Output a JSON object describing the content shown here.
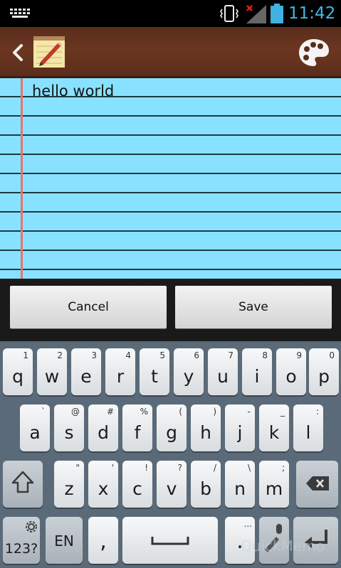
{
  "status": {
    "time": "11:42"
  },
  "header": {
    "app_icon": "notepad-pencil-icon",
    "back_icon": "back-arrow-icon",
    "palette_icon": "palette-icon"
  },
  "note": {
    "text": "hello world"
  },
  "actions": {
    "cancel_label": "Cancel",
    "save_label": "Save"
  },
  "keyboard": {
    "row1": [
      {
        "key": "q",
        "alt": "1"
      },
      {
        "key": "w",
        "alt": "2"
      },
      {
        "key": "e",
        "alt": "3"
      },
      {
        "key": "r",
        "alt": "4"
      },
      {
        "key": "t",
        "alt": "5"
      },
      {
        "key": "y",
        "alt": "6"
      },
      {
        "key": "u",
        "alt": "7"
      },
      {
        "key": "i",
        "alt": "8"
      },
      {
        "key": "o",
        "alt": "9"
      },
      {
        "key": "p",
        "alt": "0"
      }
    ],
    "row2": [
      {
        "key": "a",
        "alt": "`"
      },
      {
        "key": "s",
        "alt": "@"
      },
      {
        "key": "d",
        "alt": "#"
      },
      {
        "key": "f",
        "alt": "%"
      },
      {
        "key": "g",
        "alt": "("
      },
      {
        "key": "h",
        "alt": ")"
      },
      {
        "key": "j",
        "alt": "-"
      },
      {
        "key": "k",
        "alt": "_"
      },
      {
        "key": "l",
        "alt": ":"
      }
    ],
    "row3": [
      {
        "key": "z",
        "alt": "\""
      },
      {
        "key": "x",
        "alt": "'"
      },
      {
        "key": "c",
        "alt": "!"
      },
      {
        "key": "v",
        "alt": "?"
      },
      {
        "key": "b",
        "alt": "/"
      },
      {
        "key": "n",
        "alt": "\\"
      },
      {
        "key": "m",
        "alt": ";"
      }
    ],
    "mode_label": "123?",
    "lang_label": "EN",
    "comma": ",",
    "period": ".",
    "period_alt": "...",
    "watermark": "QuickMemo"
  }
}
